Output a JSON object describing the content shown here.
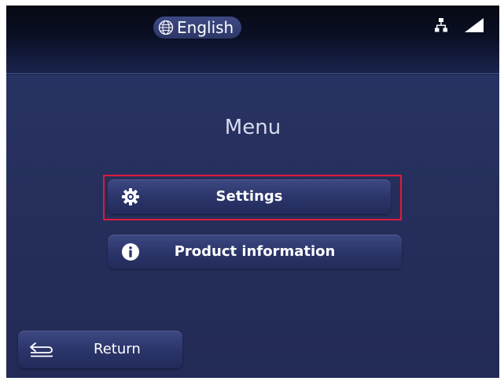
{
  "header": {
    "language_label": "English",
    "language_icon": "globe-icon",
    "status_icons": [
      "network-icon",
      "signal-icon"
    ]
  },
  "menu": {
    "title": "Menu",
    "items": [
      {
        "label": "Settings",
        "icon": "gear-icon",
        "highlighted": true
      },
      {
        "label": "Product information",
        "icon": "info-icon",
        "highlighted": false
      }
    ]
  },
  "footer": {
    "return_label": "Return",
    "return_icon": "back-arrow-icon"
  },
  "colors": {
    "background": "#262f5c",
    "topbar": "#0a0f24",
    "button": "#2f3a72",
    "highlight_border": "#e0193a",
    "text": "#ffffff"
  }
}
